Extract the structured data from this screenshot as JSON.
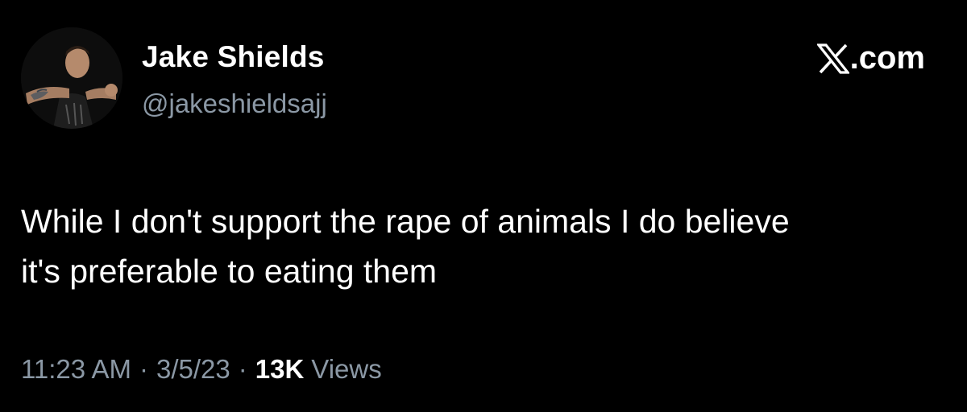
{
  "author": {
    "display_name": "Jake Shields",
    "handle": "@jakeshieldsajj",
    "avatar_icon": "profile-photo"
  },
  "brand": {
    "label": ".com",
    "icon": "x-logo-icon"
  },
  "tweet": {
    "text": "While I don't support the rape of animals I do believe\nit's preferable to eating them"
  },
  "meta": {
    "time": "11:23 AM",
    "date": "3/5/23",
    "views_count": "13K",
    "views_label": "Views",
    "separator": "·"
  },
  "colors": {
    "background": "#000000",
    "primary_text": "#ffffff",
    "secondary_text": "#8b98a5"
  }
}
